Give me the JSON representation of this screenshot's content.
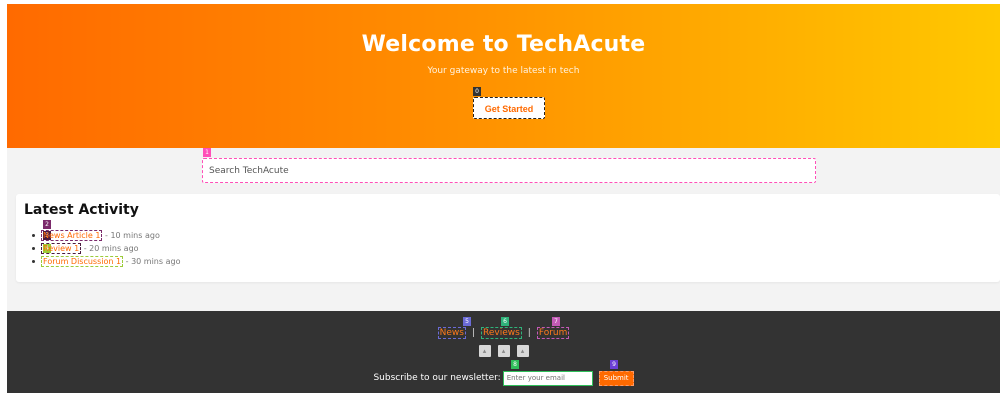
{
  "hero": {
    "title": "Welcome to TechAcute",
    "subtitle": "Your gateway to the latest in tech",
    "cta_label": "Get Started"
  },
  "search": {
    "placeholder": "Search TechAcute"
  },
  "activity": {
    "heading": "Latest Activity",
    "items": [
      {
        "title": "News Article 1",
        "time": " - 10 mins ago"
      },
      {
        "title": "Review 1",
        "time": " - 20 mins ago"
      },
      {
        "title": "Forum Discussion 1",
        "time": " - 30 mins ago"
      }
    ]
  },
  "footer": {
    "nav": [
      "News",
      "Reviews",
      "Forum"
    ],
    "separator": "|",
    "social_icons": [
      "social-icon-1",
      "social-icon-2",
      "social-icon-3"
    ],
    "newsletter_label": "Subscribe to our newsletter:",
    "email_placeholder": "Enter your email",
    "submit_label": "Submit"
  },
  "annotations": {
    "tags": [
      "0",
      "1",
      "2",
      "3",
      "4",
      "5",
      "6",
      "7",
      "8",
      "9"
    ]
  },
  "colors": {
    "accent": "#ff6a00",
    "hero_gradient_end": "#ffc800",
    "footer_bg": "#333333",
    "page_bg": "#f3f3f3"
  }
}
